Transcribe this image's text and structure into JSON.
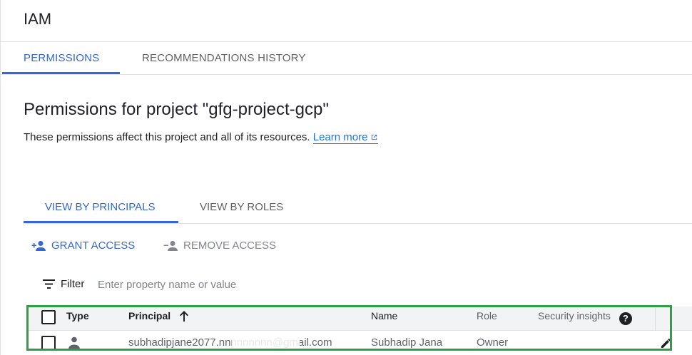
{
  "app": {
    "title": "IAM"
  },
  "tabs": [
    {
      "label": "PERMISSIONS",
      "active": true
    },
    {
      "label": "RECOMMENDATIONS HISTORY",
      "active": false
    }
  ],
  "page": {
    "heading": "Permissions for project \"gfg-project-gcp\"",
    "description": "These permissions affect this project and all of its resources.",
    "learn_more": "Learn more"
  },
  "view_tabs": [
    {
      "label": "VIEW BY PRINCIPALS",
      "active": true
    },
    {
      "label": "VIEW BY ROLES",
      "active": false
    }
  ],
  "actions": {
    "grant": "GRANT ACCESS",
    "remove": "REMOVE ACCESS"
  },
  "filter": {
    "label": "Filter",
    "placeholder": "Enter property name or value"
  },
  "table": {
    "columns": [
      "Type",
      "Principal",
      "Name",
      "Role",
      "Security insights"
    ],
    "rows": [
      {
        "principal": "subhadipjane2077.nnnnnnnnn@gmail.com",
        "name": "Subhadip Jana",
        "role": "Owner"
      }
    ]
  },
  "colors": {
    "accent": "#3367d6",
    "highlight": "#2ea043"
  },
  "icons": [
    "external-link-icon",
    "add-person-icon",
    "remove-person-icon",
    "filter-icon",
    "sort-up-icon",
    "help-icon",
    "person-icon",
    "edit-icon"
  ]
}
